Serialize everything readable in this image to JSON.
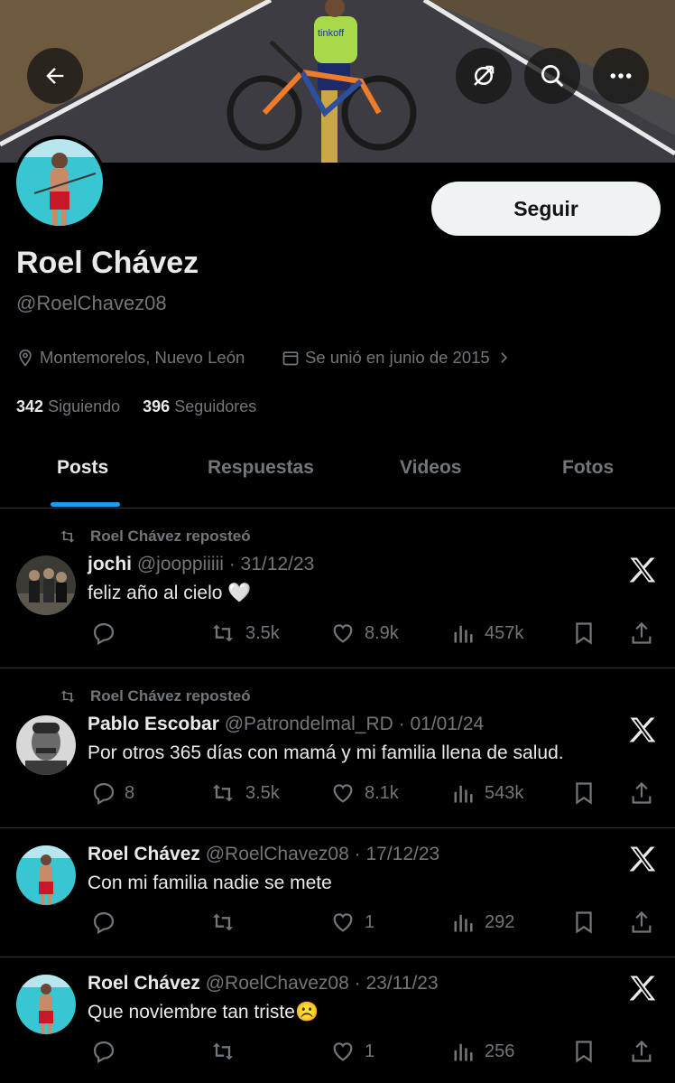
{
  "header": {
    "back_icon": "arrow-left-icon",
    "icons": [
      "hide-icon",
      "search-icon",
      "more-icon"
    ]
  },
  "banner": {
    "jersey_text": "tinkoff"
  },
  "profile": {
    "name": "Roel Chávez",
    "handle": "@RoelChavez08",
    "follow_label": "Seguir",
    "location": "Montemorelos, Nuevo León",
    "joined": "Se unió en junio de 2015",
    "following_count": "342",
    "following_label": "Siguiendo",
    "followers_count": "396",
    "followers_label": "Seguidores"
  },
  "tabs": [
    "Posts",
    "Respuestas",
    "Videos",
    "Fotos"
  ],
  "posts": [
    {
      "reposted": "Roel Chávez reposteó",
      "name": "jochi",
      "handle": "@jooppiiiii",
      "date": "· 31/12/23",
      "text": "feliz año al cielo 🤍",
      "replies": "",
      "reposts": "3.5k",
      "likes": "8.9k",
      "views": "457k"
    },
    {
      "reposted": "Roel Chávez reposteó",
      "name": "Pablo Escobar",
      "handle": "@Patrondelmal_RD",
      "date": "· 01/01/24",
      "text": "Por otros 365 días con mamá y mi familia llena de salud.",
      "replies": "8",
      "reposts": "3.5k",
      "likes": "8.1k",
      "views": "543k"
    },
    {
      "reposted": "",
      "name": "Roel Chávez",
      "handle": "@RoelChavez08",
      "date": "· 17/12/23",
      "text": "Con mi familia nadie se mete",
      "replies": "",
      "reposts": "",
      "likes": "1",
      "views": "292"
    },
    {
      "reposted": "",
      "name": "Roel Chávez",
      "handle": "@RoelChavez08",
      "date": "· 23/11/23",
      "text": "Que noviembre tan triste☹️",
      "replies": "",
      "reposts": "",
      "likes": "1",
      "views": "256"
    }
  ]
}
